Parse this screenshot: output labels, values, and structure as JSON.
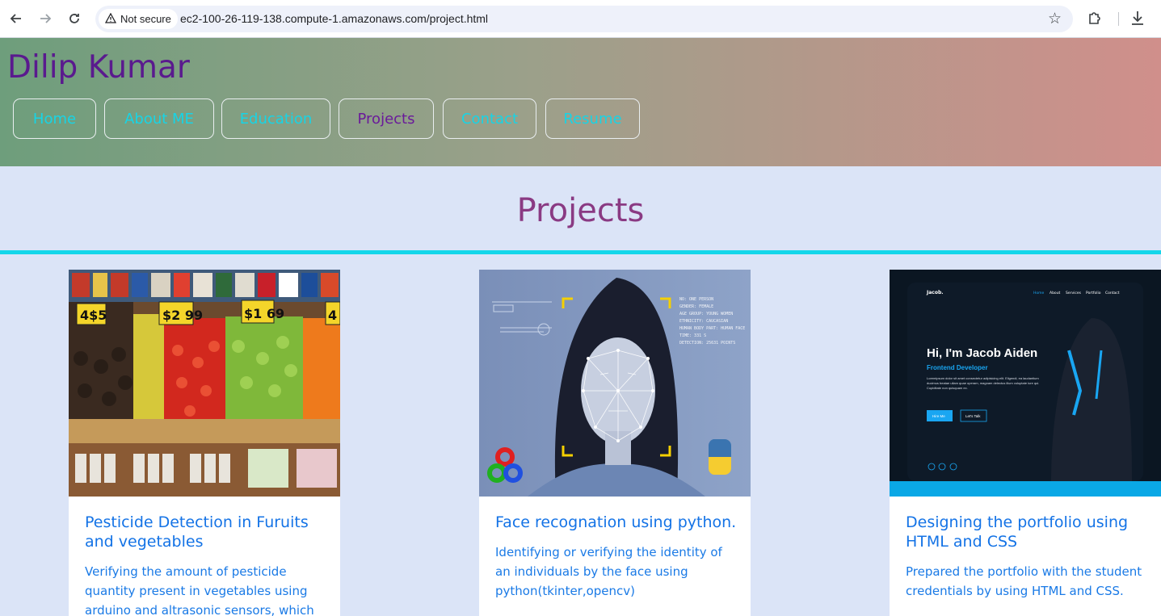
{
  "browser": {
    "security_label": "Not secure",
    "url": "ec2-100-26-119-138.compute-1.amazonaws.com/project.html"
  },
  "header": {
    "title": "Dilip Kumar",
    "nav": [
      "Home",
      "About ME",
      "Education",
      "Projects",
      "Contact",
      "Resume"
    ],
    "active": "Projects"
  },
  "section": {
    "heading": "Projects"
  },
  "projects": [
    {
      "title": "Pesticide Detection in Furuits and vegetables",
      "description": "Verifying the amount of pesticide quantity present in vegetables using arduino and altrasonic sensors, which is",
      "image": "fruit-market-photo",
      "price_tags": [
        "4$5",
        "$2 99",
        "$1 69",
        "4"
      ]
    },
    {
      "title": "Face recognation using python.",
      "description": "Identifying or verifying the identity of an individuals by the face using python(tkinter,opencv)",
      "image": "face-recognition-image",
      "overlay_lines": [
        "NO: ONE PERSON",
        "GENDER: FEMALE",
        "AGE GROUP: YOUNG WOMEN",
        "ETHNICITY: CAUCASIAN",
        "HUMAN BODY PART: HUMAN FACE",
        "TIME: 331 S",
        "DETECTION: 25631 POINTS"
      ]
    },
    {
      "title": "Designing the portfolio using HTML and CSS",
      "description": "Prepared the portfolio with the student credentials by using HTML and CSS.",
      "image": "portfolio-screenshot",
      "mock": {
        "logo": "Jacob.",
        "nav": [
          "Home",
          "About",
          "Services",
          "Portfolio",
          "Contact"
        ],
        "heading": "Hi, I'm Jacob Aiden",
        "subheading": "Frontend Developer",
        "body": "Loremipsum dolor sit amet consectetur adipisicing elit. Eligendi, ea laudantium ducimus beatae ullam quae operam, magnam delectus illum voluptate iure qui. Cupiditate non quisquam ex.",
        "btn_primary": "Hire Me",
        "btn_secondary": "Let's Talk"
      }
    }
  ]
}
